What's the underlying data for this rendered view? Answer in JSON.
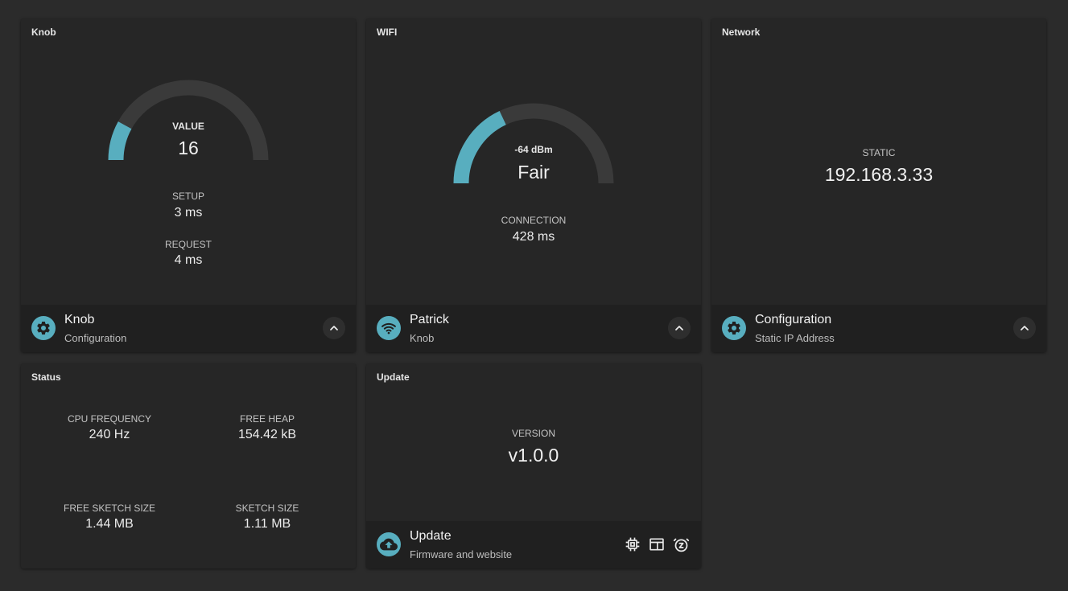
{
  "colors": {
    "accent": "#58aebf",
    "card": "#262626",
    "footer": "#202020",
    "background": "#2b2b2b",
    "track": "#3a3a3a"
  },
  "knob": {
    "title": "Knob",
    "gauge": {
      "label": "VALUE",
      "value": "16",
      "fill_fraction": 0.16
    },
    "setup": {
      "label": "SETUP",
      "value": "3 ms"
    },
    "request": {
      "label": "REQUEST",
      "value": "4 ms"
    },
    "footer": {
      "title": "Knob",
      "subtitle": "Configuration",
      "icon": "gear-icon",
      "button_icon": "chevron-up-icon"
    }
  },
  "wifi": {
    "title": "WIFI",
    "gauge": {
      "label": "-64 dBm",
      "value": "Fair",
      "fill_fraction": 0.36
    },
    "connection": {
      "label": "CONNECTION",
      "value": "428 ms"
    },
    "footer": {
      "title": "Patrick",
      "subtitle": "Knob",
      "icon": "wifi-icon",
      "button_icon": "chevron-up-icon"
    }
  },
  "network": {
    "title": "Network",
    "mode": {
      "label": "STATIC",
      "value": "192.168.3.33"
    },
    "footer": {
      "title": "Configuration",
      "subtitle": "Static IP Address",
      "icon": "gear-icon",
      "button_icon": "chevron-up-icon"
    }
  },
  "status": {
    "title": "Status",
    "stats": [
      {
        "label": "CPU FREQUENCY",
        "value": "240 Hz"
      },
      {
        "label": "FREE HEAP",
        "value": "154.42 kB"
      },
      {
        "label": "FREE SKETCH SIZE",
        "value": "1.44 MB"
      },
      {
        "label": "SKETCH SIZE",
        "value": "1.11 MB"
      }
    ]
  },
  "update": {
    "title": "Update",
    "version": {
      "label": "VERSION",
      "value": "v1.0.0"
    },
    "footer": {
      "title": "Update",
      "subtitle": "Firmware and website",
      "icon": "cloud-upload-icon",
      "tools": [
        "chip-icon",
        "browser-window-icon",
        "alarm-snooze-icon"
      ]
    }
  }
}
